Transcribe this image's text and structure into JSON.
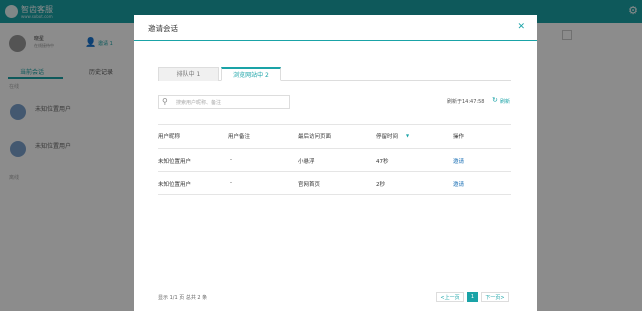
{
  "app": {
    "logo_text": "智齿客服",
    "logo_sub": "www.sobot.com",
    "agent_name": "晓星",
    "agent_status": "在线接待中",
    "invite_label": "邀请 1",
    "left_tabs": [
      "当前会话",
      "历史记录"
    ],
    "section_online": "在线",
    "section_offline": "离线",
    "conversations": [
      {
        "label": "未知位置用户",
        "time": "14:47:33"
      },
      {
        "label": "未知位置用户",
        "time": "14:47:15"
      }
    ]
  },
  "modal": {
    "title": "邀请会话",
    "close_icon": "close-icon",
    "tabs": [
      "排队中 1",
      "浏览网站中 2"
    ],
    "active_tab": 1,
    "search_placeholder": "搜索用户昵称、备注",
    "refresh_time": "刷新于14:47:58",
    "refresh_label": "刷新",
    "columns": [
      "用户昵称",
      "用户备注",
      "最后访问页面",
      "停留时间",
      "操作"
    ],
    "rows": [
      {
        "nickname": "未知位置用户",
        "note": "-",
        "last_page": "小悬浮",
        "stay": "47秒",
        "action": "邀请"
      },
      {
        "nickname": "未知位置用户",
        "note": "-",
        "last_page": "官网首页",
        "stay": "2秒",
        "action": "邀请"
      }
    ],
    "footer_info": "显示 1/1 页  总共 2 条",
    "pagination": {
      "prev": "<上一页",
      "current": "1",
      "next": "下一页>"
    }
  },
  "colors": {
    "accent": "#1aa3a7",
    "link": "#1a6fb5"
  }
}
